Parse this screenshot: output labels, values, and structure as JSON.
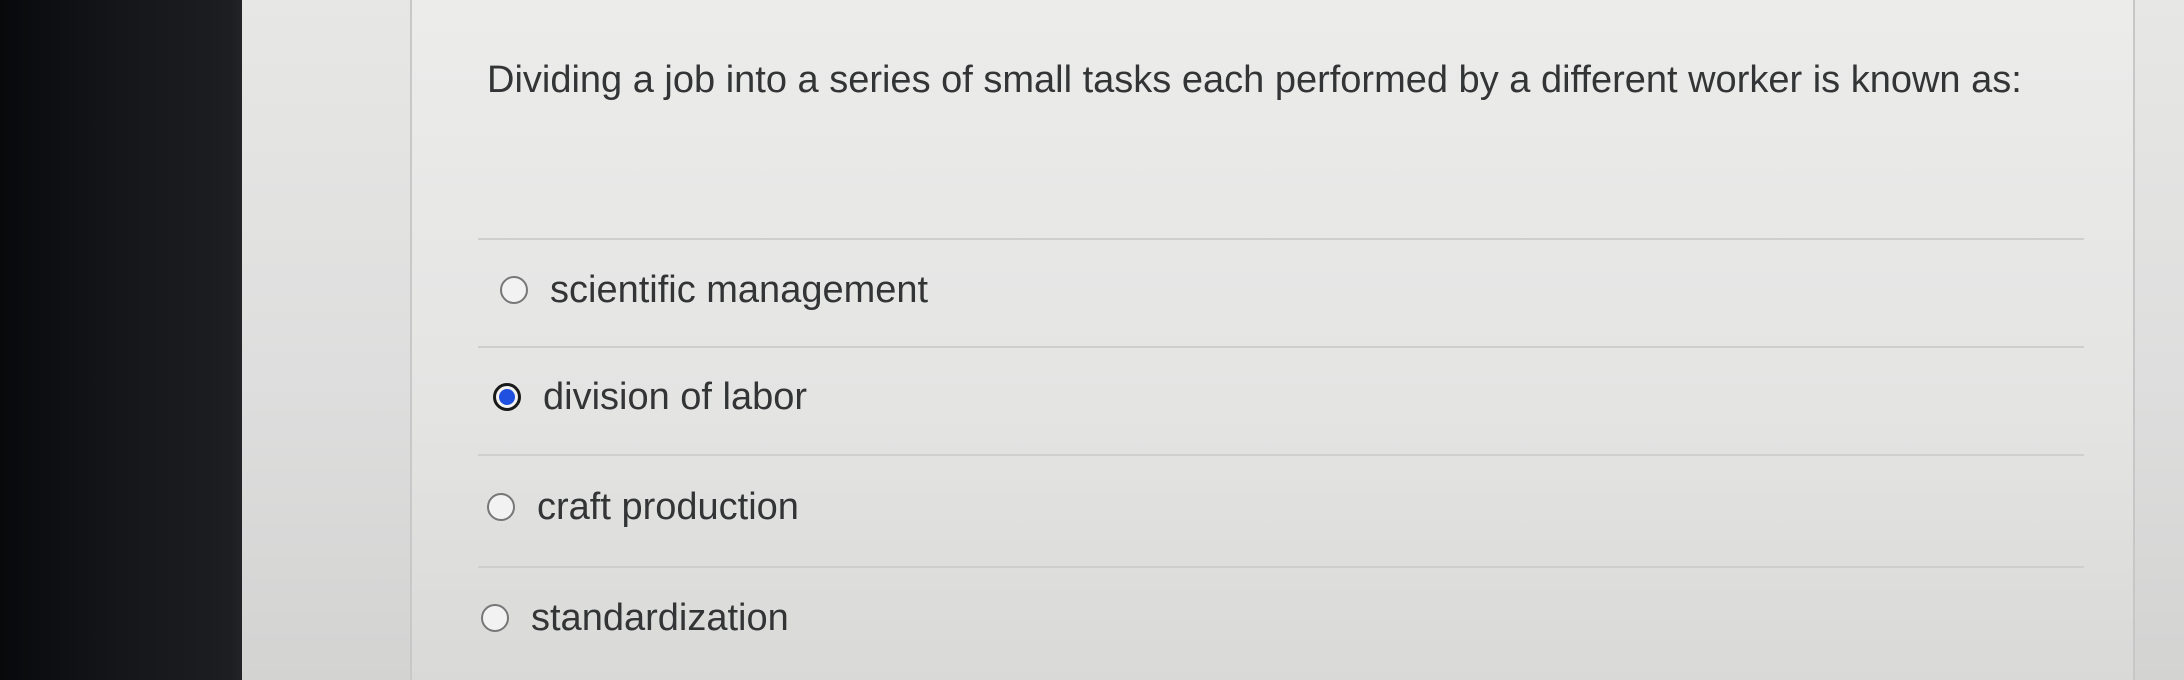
{
  "quiz": {
    "question": "Dividing a job into a series of small tasks each performed by a different worker is known as:",
    "options": [
      {
        "label": "scientific management",
        "selected": false
      },
      {
        "label": "division of labor",
        "selected": true
      },
      {
        "label": "craft production",
        "selected": false
      },
      {
        "label": "standardization",
        "selected": false
      }
    ],
    "selected_option": "division of labor"
  },
  "colors": {
    "radio_selected_fill": "#1f50e0",
    "text": "#333435",
    "panel_background": "#e6e6e5"
  }
}
